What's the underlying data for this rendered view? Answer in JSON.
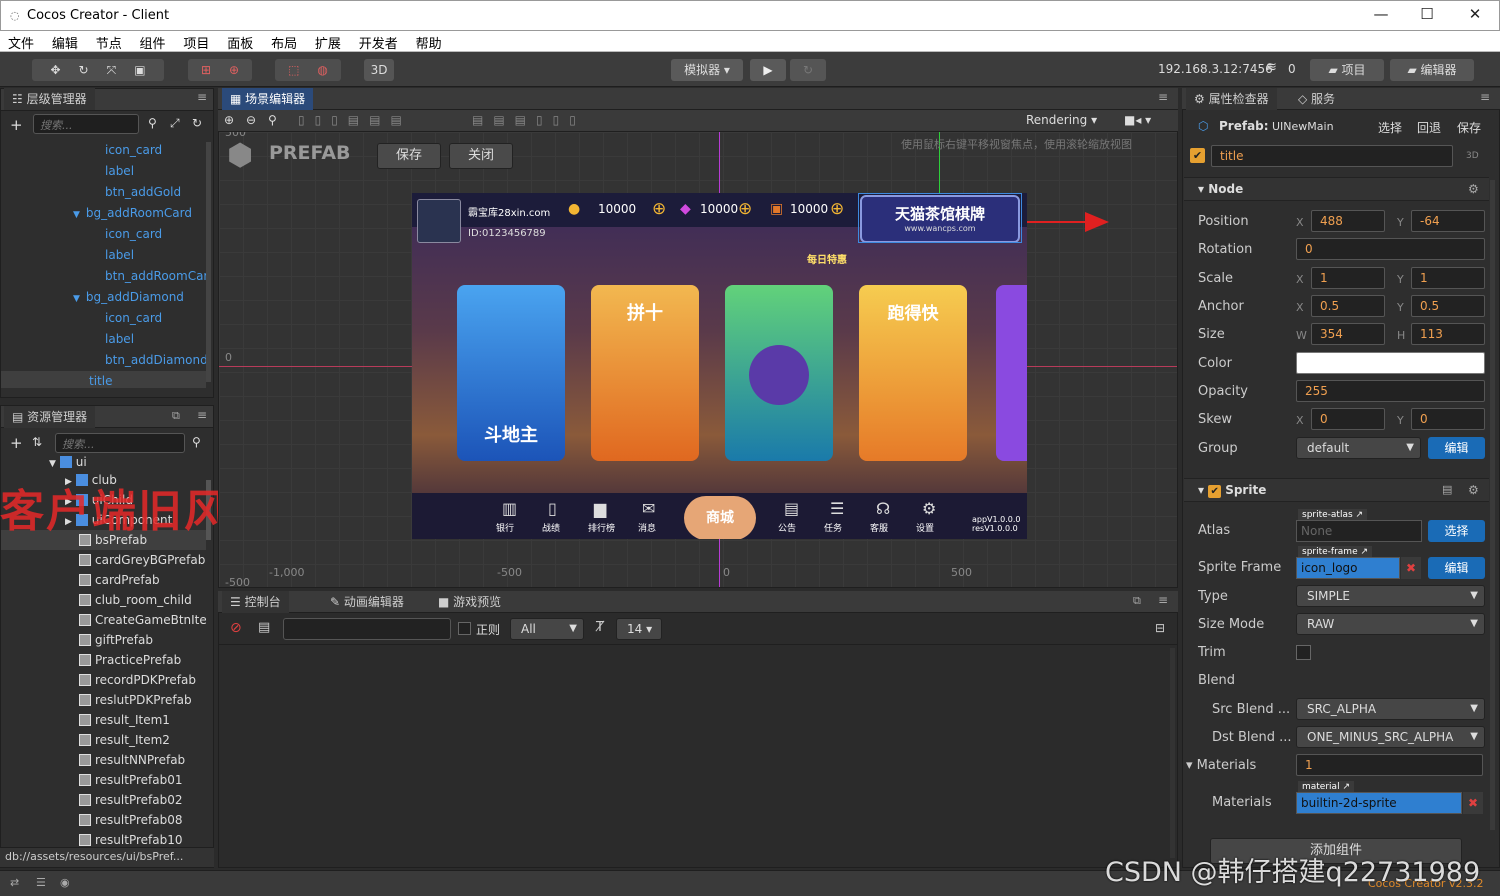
{
  "window": {
    "title": "Cocos Creator - Client",
    "min": "—",
    "max": "☐",
    "close": "✕"
  },
  "menu": [
    "文件",
    "编辑",
    "节点",
    "组件",
    "项目",
    "面板",
    "布局",
    "扩展",
    "开发者",
    "帮助"
  ],
  "toolbar": {
    "mode3d": "3D",
    "simulator": "模拟器 ▾",
    "play": "▶",
    "refresh": "↻",
    "ip": "192.168.3.12:7456",
    "count": "0",
    "project": "项目",
    "editor": "编辑器"
  },
  "hierarchy": {
    "tab": "层级管理器",
    "search_placeholder": "搜索...",
    "items": [
      {
        "label": "icon_card",
        "indent": 3
      },
      {
        "label": "label",
        "indent": 3
      },
      {
        "label": "btn_addGold",
        "indent": 3
      },
      {
        "label": "bg_addRoomCard",
        "indent": 2,
        "arrow": "▼"
      },
      {
        "label": "icon_card",
        "indent": 3
      },
      {
        "label": "label",
        "indent": 3
      },
      {
        "label": "btn_addRoomCar",
        "indent": 3
      },
      {
        "label": "bg_addDiamond",
        "indent": 2,
        "arrow": "▼"
      },
      {
        "label": "icon_card",
        "indent": 3
      },
      {
        "label": "label",
        "indent": 3
      },
      {
        "label": "btn_addDiamond",
        "indent": 3
      },
      {
        "label": "title",
        "indent": 1,
        "selected": true
      }
    ]
  },
  "assets": {
    "tab": "资源管理器",
    "search_placeholder": "搜索...",
    "folders": [
      "ui",
      "club",
      "uiChild",
      "uiComponent"
    ],
    "items": [
      "bsPrefab",
      "cardGreyBGPrefab",
      "cardPrefab",
      "club_room_child",
      "CreateGameBtnIter",
      "giftPrefab",
      "PracticePrefab",
      "recordPDKPrefab",
      "reslutPDKPrefab",
      "result_Item1",
      "result_Item2",
      "resultNNPrefab",
      "resultPrefab01",
      "resultPrefab02",
      "resultPrefab08",
      "resultPrefab10"
    ],
    "path": "db://assets/resources/ui/bsPref..."
  },
  "watermark_red": "客户端旧风格",
  "scene": {
    "tab": "场景编辑器",
    "rendering": "Rendering",
    "prefab_logo": "PREFAB",
    "save": "保存",
    "close": "关闭",
    "hint": "使用鼠标右键平移视窗焦点，使用滚轮缩放视图",
    "axis_x": [
      "-1,000",
      "-500",
      "0",
      "500"
    ],
    "axis_y": [
      "500",
      "0",
      "-500"
    ],
    "game": {
      "name": "霸宝库28xin.com",
      "id": "ID:0123456789",
      "gold": "10000",
      "diamond": "10000",
      "card": "10000",
      "brand": "天猫茶馆棋牌",
      "brand_url": "www.wancps.com",
      "daily": "每日特惠",
      "cards": [
        "斗地主",
        "拼十",
        "",
        "跑得快"
      ],
      "bottom": [
        "银行",
        "战绩",
        "排行榜",
        "消息",
        "商城",
        "公告",
        "任务",
        "客服",
        "设置"
      ],
      "version": "appV1.0.0.0\nresV1.0.0.0"
    }
  },
  "console": {
    "tabs": [
      "控制台",
      "动画编辑器",
      "游戏预览"
    ],
    "regex": "正则",
    "filter": "All",
    "fontsize": "14 ▾"
  },
  "inspector": {
    "tabs": [
      "属性检查器",
      "服务"
    ],
    "prefab_label": "Prefab:",
    "prefab_name": "UINewMain",
    "select": "选择",
    "revert": "回退",
    "save": "保存",
    "node_name": "title",
    "badge3d": "3D",
    "node_section": "Node",
    "position": {
      "x": "488",
      "y": "-64"
    },
    "rotation": "0",
    "scale": {
      "x": "1",
      "y": "1"
    },
    "anchor": {
      "x": "0.5",
      "y": "0.5"
    },
    "size": {
      "w": "354",
      "h": "113"
    },
    "opacity": "255",
    "skew": {
      "x": "0",
      "y": "0"
    },
    "group": "default",
    "edit": "编辑",
    "labels": {
      "position": "Position",
      "rotation": "Rotation",
      "scale": "Scale",
      "anchor": "Anchor",
      "size": "Size",
      "color": "Color",
      "opacity": "Opacity",
      "skew": "Skew",
      "group": "Group"
    },
    "sprite_section": "Sprite",
    "sprite": {
      "atlas_label": "Atlas",
      "atlas_tag": "sprite-atlas",
      "atlas_value": "None",
      "choose": "选择",
      "frame_label": "Sprite Frame",
      "frame_tag": "sprite-frame",
      "frame_value": "icon_logo",
      "type_label": "Type",
      "type": "SIMPLE",
      "sizemode_label": "Size Mode",
      "sizemode": "RAW",
      "trim_label": "Trim",
      "blend_label": "Blend",
      "src_label": "Src Blend ...",
      "src": "SRC_ALPHA",
      "dst_label": "Dst Blend ...",
      "dst": "ONE_MINUS_SRC_ALPHA",
      "materials_label": "Materials",
      "materials_count": "1",
      "material_tag": "material",
      "material_value": "builtin-2d-sprite"
    },
    "add_component": "添加组件"
  },
  "footer": {
    "watermark": "CSDN @韩仔搭建q22731989",
    "version": "Cocos Creator v2.3.2"
  }
}
